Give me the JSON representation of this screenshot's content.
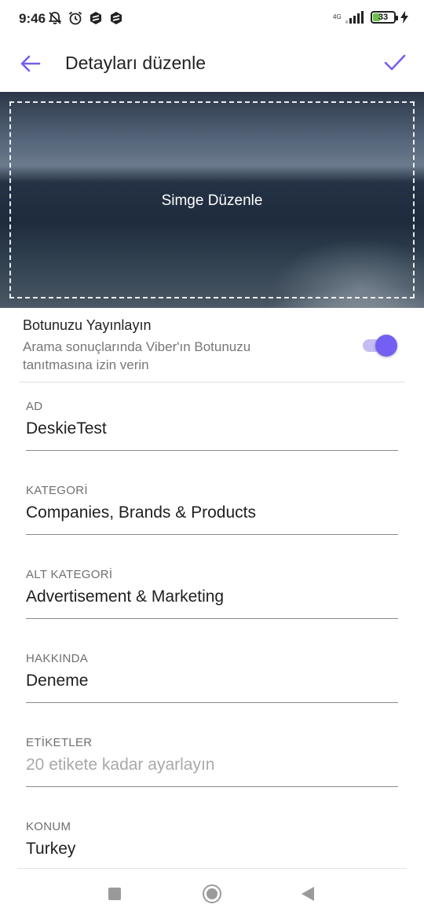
{
  "status_bar": {
    "time": "9:46",
    "network": "4G",
    "battery": "33",
    "battery_level": 0.33,
    "icons": [
      "muted-bell-icon",
      "alarm-icon",
      "app-icon",
      "app-icon",
      "signal-icon",
      "battery-icon",
      "charging-icon"
    ]
  },
  "header": {
    "title": "Detayları düzenle",
    "accent_color": "#7360f2"
  },
  "cover": {
    "label": "Simge Düzenle"
  },
  "publish": {
    "title": "Botunuzu Yayınlayın",
    "description": "Arama sonuçlarında Viber'ın Botunuzu tanıtmasına izin verin",
    "enabled": true
  },
  "fields": [
    {
      "label": "AD",
      "value": "DeskieTest",
      "is_placeholder": false
    },
    {
      "label": "KATEGORİ",
      "value": "Companies, Brands & Products",
      "is_placeholder": false
    },
    {
      "label": "ALT KATEGORİ",
      "value": "Advertisement & Marketing",
      "is_placeholder": false
    },
    {
      "label": "HAKKINDA",
      "value": "Deneme",
      "is_placeholder": false
    },
    {
      "label": "ETİKETLER",
      "value": "20 etikete kadar ayarlayın",
      "is_placeholder": true
    },
    {
      "label": "KONUM",
      "value": "Turkey",
      "is_placeholder": false
    }
  ]
}
